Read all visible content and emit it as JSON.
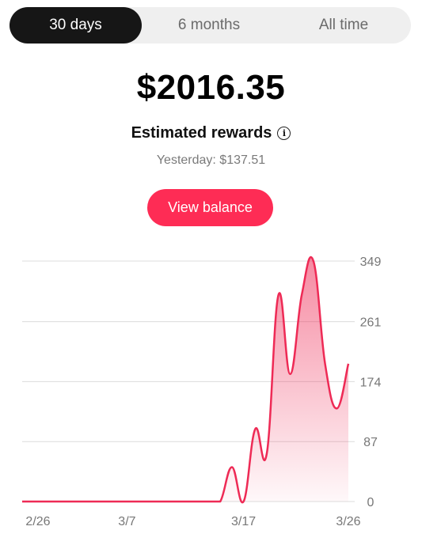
{
  "tabs": [
    {
      "label": "30 days",
      "active": true
    },
    {
      "label": "6 months",
      "active": false
    },
    {
      "label": "All time",
      "active": false
    }
  ],
  "summary": {
    "amount": "$2016.35",
    "rewards_label": "Estimated rewards",
    "info_icon": "info-icon",
    "yesterday": "Yesterday: $137.51"
  },
  "view_balance_label": "View balance",
  "colors": {
    "accent": "#fe2c55",
    "line": "#ee2a55",
    "tab_active_bg": "#161616"
  },
  "chart_data": {
    "type": "area",
    "x": [
      0,
      1,
      2,
      3,
      4,
      5,
      6,
      7,
      8,
      9,
      10,
      11,
      12,
      13,
      14,
      15,
      16,
      17,
      18,
      19,
      20,
      21,
      22,
      23,
      24,
      25,
      26,
      27,
      28,
      29
    ],
    "values": [
      0,
      0,
      0,
      0,
      0,
      0,
      0,
      0,
      0,
      0,
      0,
      0,
      0,
      0,
      0,
      0,
      0,
      0,
      50,
      0,
      105,
      70,
      300,
      185,
      300,
      349,
      200,
      135,
      200
    ],
    "y_ticks": [
      "0",
      "87",
      "174",
      "261",
      "349"
    ],
    "ylim": [
      0,
      349
    ],
    "x_ticks": [
      {
        "label": "2/26",
        "index": 0
      },
      {
        "label": "3/7",
        "index": 9
      },
      {
        "label": "3/17",
        "index": 19
      },
      {
        "label": "3/26",
        "index": 28
      }
    ],
    "grid": true
  }
}
